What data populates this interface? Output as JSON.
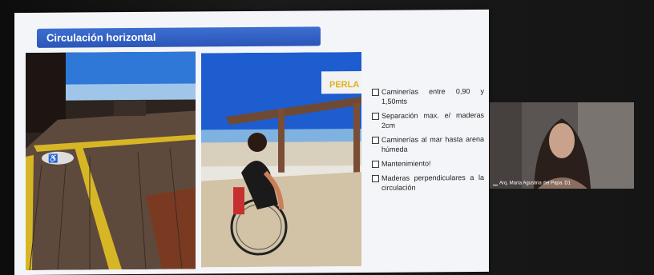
{
  "slide": {
    "title": "Circulación horizontal",
    "bullets": [
      "Caminerías entre 0,90 y 1,50mts",
      "Separación max. e/ maderas 2cm",
      "Caminerías al mar hasta arena húmeda",
      "Mantenimiento!",
      "Maderas perpendiculares a la circulación"
    ],
    "photo2_sign": "PERLA"
  },
  "video": {
    "participant_name": "Arq. María Agustina del Papa. D1"
  },
  "colors": {
    "title_bar": "#2f5fc4",
    "slide_bg": "#f4f5f8"
  }
}
